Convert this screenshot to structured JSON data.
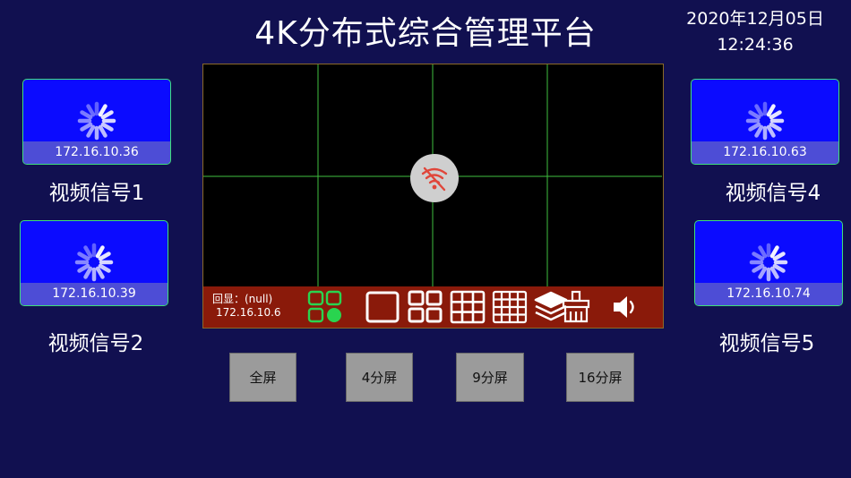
{
  "header": {
    "title": "4K分布式综合管理平台",
    "date": "2020年12月05日",
    "time": "12:24:36"
  },
  "sources": [
    {
      "ip": "172.16.10.36",
      "label": "视频信号1"
    },
    {
      "ip": "172.16.10.39",
      "label": "视频信号2"
    },
    {
      "ip": "172.16.10.63",
      "label": "视频信号4"
    },
    {
      "ip": "172.16.10.74",
      "label": "视频信号5"
    }
  ],
  "monitor": {
    "echo_label": "回显：(null)",
    "echo_ip": "172.16.10.6"
  },
  "layout_buttons": [
    {
      "label": "全屏"
    },
    {
      "label": "4分屏"
    },
    {
      "label": "9分屏"
    },
    {
      "label": "16分屏"
    }
  ],
  "colors": {
    "background": "#111050",
    "source_tile": "#0b0bff",
    "tile_border": "#3fe07a",
    "toolbar": "#8a1a0a",
    "grid_line": "#3fbf3f",
    "wifi_icon": "#e0463a"
  },
  "icons": [
    "loading-spinner-icon",
    "wifi-off-icon",
    "group-layout-icon",
    "full-screen-icon",
    "four-split-icon",
    "nine-split-icon",
    "sixteen-split-icon",
    "layers-icon",
    "clear-brush-icon",
    "speaker-icon"
  ]
}
